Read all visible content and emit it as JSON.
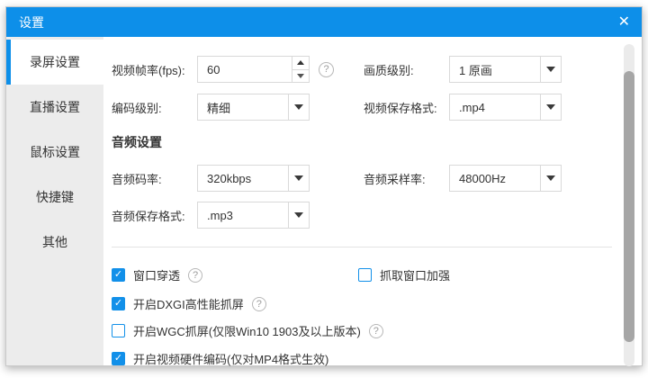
{
  "titlebar": {
    "title": "设置",
    "close": "✕"
  },
  "sidebar": {
    "items": [
      {
        "label": "录屏设置",
        "active": true
      },
      {
        "label": "直播设置",
        "active": false
      },
      {
        "label": "鼠标设置",
        "active": false
      },
      {
        "label": "快捷键",
        "active": false
      },
      {
        "label": "其他",
        "active": false
      }
    ]
  },
  "form": {
    "fps": {
      "label": "视频帧率(fps):",
      "value": "60"
    },
    "quality": {
      "label": "画质级别:",
      "value": "1 原画"
    },
    "encode": {
      "label": "编码级别:",
      "value": "精细"
    },
    "video_format": {
      "label": "视频保存格式:",
      "value": ".mp4"
    },
    "audio_header": "音频设置",
    "audio_bitrate": {
      "label": "音频码率:",
      "value": "320kbps"
    },
    "audio_sample": {
      "label": "音频采样率:",
      "value": "48000Hz"
    },
    "audio_format": {
      "label": "音频保存格式:",
      "value": ".mp3"
    }
  },
  "checkboxes": [
    {
      "label": "窗口穿透",
      "checked": true,
      "help": true
    },
    {
      "label": "抓取窗口加强",
      "checked": false,
      "help": false
    },
    {
      "label": "开启DXGI高性能抓屏",
      "checked": true,
      "help": true
    },
    {
      "label": "开启WGC抓屏(仅限Win10 1903及以上版本)",
      "checked": false,
      "help": true
    },
    {
      "label": "开启视频硬件编码(仅对MP4格式生效)",
      "checked": true,
      "help": false
    }
  ],
  "icons": {
    "help": "?",
    "check": "✓"
  },
  "colors": {
    "accent": "#0d8fe9",
    "checkbox_blue": "#1290e9"
  }
}
